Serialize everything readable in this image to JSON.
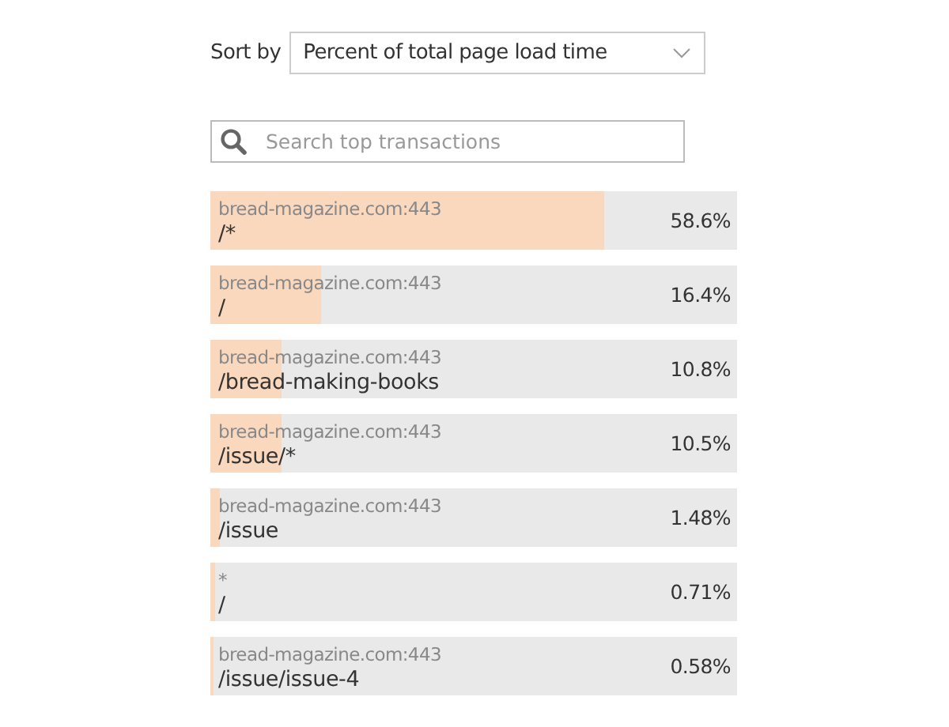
{
  "sort": {
    "label": "Sort by",
    "value": "Percent of total page load time"
  },
  "search": {
    "placeholder": "Search top transactions"
  },
  "transactions": [
    {
      "host": "bread-magazine.com:443",
      "path": "/*",
      "percent": "58.6%",
      "level": 0.748
    },
    {
      "host": "bread-magazine.com:443",
      "path": "/",
      "percent": "16.4%",
      "level": 0.21
    },
    {
      "host": "bread-magazine.com:443",
      "path": "/bread-making-books",
      "percent": "10.8%",
      "level": 0.135
    },
    {
      "host": "bread-magazine.com:443",
      "path": "/issue/*",
      "percent": "10.5%",
      "level": 0.135
    },
    {
      "host": "bread-magazine.com:443",
      "path": "/issue",
      "percent": "1.48%",
      "level": 0.018
    },
    {
      "host": "*",
      "path": "/",
      "percent": "0.71%",
      "level": 0.009
    },
    {
      "host": "bread-magazine.com:443",
      "path": "/issue/issue-4",
      "percent": "0.58%",
      "level": 0.006
    }
  ]
}
